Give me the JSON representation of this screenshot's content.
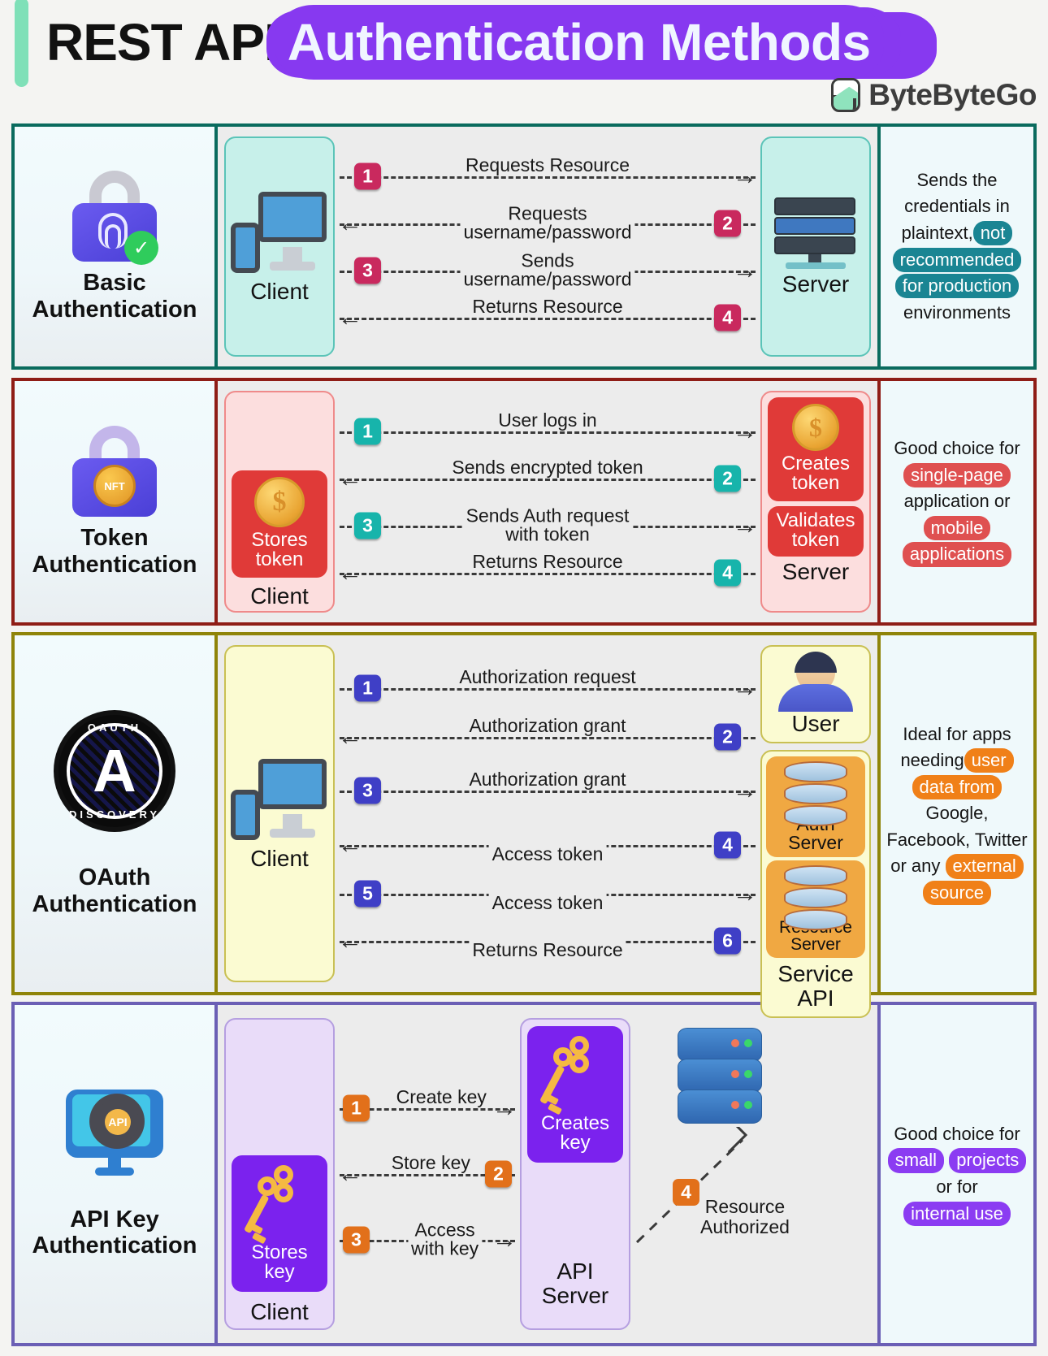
{
  "header": {
    "title_plain": "REST API",
    "title_highlight": "Authentication Methods",
    "brand": "ByteByteGo",
    "highlight_color": "#8739f0",
    "accent_bar_color": "#7fe0b8"
  },
  "rows": [
    {
      "id": "basic",
      "name": "Basic\nAuthentication",
      "name_line1": "Basic",
      "name_line2": "Authentication",
      "border_color": "#0a6b5e",
      "node_bg": "#c7f0ea",
      "node_border": "#5bc4b8",
      "badge_color": "#c9295e",
      "highlight_color": "#1a8593",
      "icon": "padlock-fingerprint-icon",
      "client_label": "Client",
      "server_label": "Server",
      "steps": [
        {
          "n": "1",
          "text": "Requests Resource",
          "dir": "right",
          "pos": "above"
        },
        {
          "n": "2",
          "text": "Requests\nusername/password",
          "line1": "Requests",
          "line2": "username/password",
          "dir": "left",
          "pos": "center2"
        },
        {
          "n": "3",
          "text": "Sends\nusername/password",
          "line1": "Sends",
          "line2": "username/password",
          "dir": "right",
          "pos": "center2"
        },
        {
          "n": "4",
          "text": "Returns Resource",
          "dir": "left",
          "pos": "above"
        }
      ],
      "desc_parts": [
        {
          "t": "Sends the credentials in plaintext,",
          "hl": false
        },
        {
          "t": "not",
          "hl": true
        },
        {
          "t": "recommended",
          "hl": true
        },
        {
          "t": "for production",
          "hl": true
        },
        {
          "t": "environments",
          "hl": false
        }
      ]
    },
    {
      "id": "token",
      "name_line1": "Token",
      "name_line2": "Authentication",
      "border_color": "#8f1d16",
      "node_bg": "#fcdede",
      "node_border": "#ef8a8a",
      "badge_color": "#17b4ab",
      "highlight_color": "#df5050",
      "chip_color": "#e03a38",
      "icon": "padlock-nft-coin-icon",
      "client_label": "Client",
      "server_label": "Server",
      "client_chip": "Stores\ntoken",
      "client_chip_l1": "Stores",
      "client_chip_l2": "token",
      "server_chip1_l1": "Creates",
      "server_chip1_l2": "token",
      "server_chip2_l1": "Validates",
      "server_chip2_l2": "token",
      "steps": [
        {
          "n": "1",
          "text": "User logs in",
          "dir": "right",
          "pos": "above"
        },
        {
          "n": "2",
          "text": "Sends encrypted token",
          "dir": "left",
          "pos": "above"
        },
        {
          "n": "3",
          "text": "Sends Auth request\nwith token",
          "line1": "Sends Auth request",
          "line2": "with token",
          "dir": "right",
          "pos": "center2"
        },
        {
          "n": "4",
          "text": "Returns Resource",
          "dir": "left",
          "pos": "above"
        }
      ],
      "desc_parts": [
        {
          "t": "Good choice for",
          "hl": false
        },
        {
          "t": "single-page",
          "hl": true
        },
        {
          "t": "application or",
          "hl": false
        },
        {
          "t": "mobile",
          "hl": true
        },
        {
          "t": "applications",
          "hl": true
        }
      ]
    },
    {
      "id": "oauth",
      "name_line1": "OAuth",
      "name_line2": "Authentication",
      "border_color": "#8f8409",
      "node_bg": "#fbfbd2",
      "node_border": "#c9c054",
      "badge_color": "#3f3fc6",
      "highlight_color": "#f08018",
      "icon": "oauth-discovery-logo",
      "oauth_top": "OAUTH",
      "oauth_bottom": "DISCOVERY",
      "oauth_letter": "A",
      "client_label": "Client",
      "user_label": "User",
      "auth_server_l1": "Auth",
      "auth_server_l2": "Server",
      "resource_server_l1": "Resource",
      "resource_server_l2": "Server",
      "service_api_l1": "Service",
      "service_api_l2": "API",
      "steps": [
        {
          "n": "1",
          "text": "Authorization request",
          "dir": "right",
          "pos": "above"
        },
        {
          "n": "2",
          "text": "Authorization grant",
          "dir": "left",
          "pos": "above"
        },
        {
          "n": "3",
          "text": "Authorization grant",
          "dir": "right",
          "pos": "above"
        },
        {
          "n": "4",
          "text": "Access token",
          "dir": "left",
          "pos": "below"
        },
        {
          "n": "5",
          "text": "Access token",
          "dir": "right",
          "pos": "below"
        },
        {
          "n": "6",
          "text": "Returns Resource",
          "dir": "left",
          "pos": "below"
        }
      ],
      "desc_parts": [
        {
          "t": "Ideal for apps needing",
          "hl": false
        },
        {
          "t": "user",
          "hl": true
        },
        {
          "t": "data from",
          "hl": true
        },
        {
          "t": "Google, Facebook, Twitter or any",
          "hl": false
        },
        {
          "t": "external",
          "hl": true
        },
        {
          "t": "source",
          "hl": true
        }
      ]
    },
    {
      "id": "apikey",
      "name_line1": "API Key",
      "name_line2": "Authentication",
      "border_color": "#6b5fb5",
      "node_bg": "#e9dcf9",
      "node_border": "#b59fe0",
      "badge_color": "#e2701a",
      "highlight_color": "#8b3cf2",
      "chip_color": "#7b22ee",
      "icon": "api-gear-monitor-icon",
      "client_label": "Client",
      "api_server_l1": "API",
      "api_server_l2": "Server",
      "client_chip_l1": "Stores",
      "client_chip_l2": "key",
      "server_chip_l1": "Creates",
      "server_chip_l2": "key",
      "resource_l1": "Resource",
      "resource_l2": "Authorized",
      "steps": [
        {
          "n": "1",
          "text": "Create key",
          "dir": "right",
          "pos": "above"
        },
        {
          "n": "2",
          "text": "Store key",
          "dir": "left",
          "pos": "above"
        },
        {
          "n": "3",
          "text": "Access\nwith key",
          "line1": "Access",
          "line2": "with key",
          "dir": "right",
          "pos": "center2"
        },
        {
          "n": "4",
          "text": "",
          "dir": "diagonal",
          "pos": "none"
        }
      ],
      "desc_parts": [
        {
          "t": "Good choice for",
          "hl": false
        },
        {
          "t": "small",
          "hl": true
        },
        {
          "t": "projects",
          "hl": true
        },
        {
          "t": "or for",
          "hl": false
        },
        {
          "t": "internal use",
          "hl": true
        }
      ]
    }
  ]
}
